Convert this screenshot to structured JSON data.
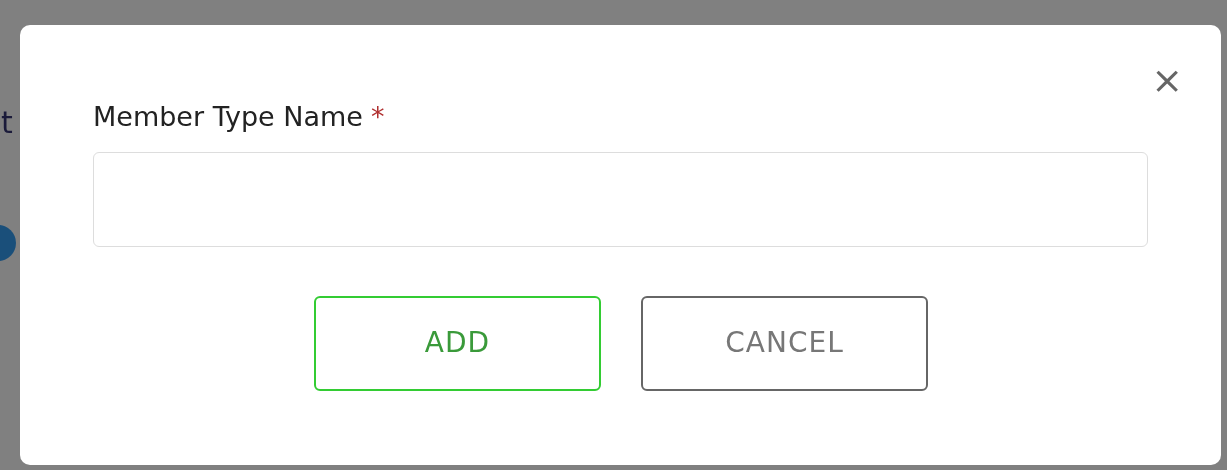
{
  "background": {
    "texts": [
      "t"
    ]
  },
  "dialog": {
    "close": "×",
    "field": {
      "label": "Member Type Name",
      "required_mark": "*"
    },
    "buttons": [
      {
        "label": "ADD",
        "kind": "primary"
      },
      {
        "label": "CANCEL",
        "kind": "secondary"
      }
    ]
  }
}
